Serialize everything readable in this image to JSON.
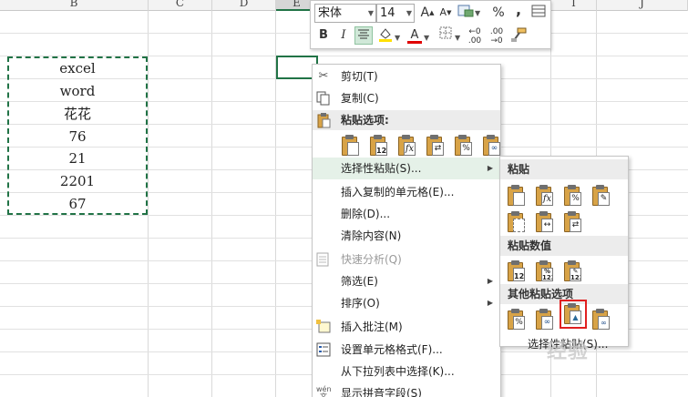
{
  "columns": [
    {
      "label": "B",
      "active": false
    },
    {
      "label": "C",
      "active": false
    },
    {
      "label": "D",
      "active": false
    },
    {
      "label": "E",
      "active": true
    },
    {
      "label": "I",
      "active": false
    },
    {
      "label": "J",
      "active": false
    }
  ],
  "cells": [
    "excel",
    "word",
    "花花",
    "76",
    "21",
    "2201",
    "67"
  ],
  "mini_toolbar": {
    "font_name": "宋体",
    "font_size": "14",
    "grow_font": "A",
    "shrink_font": "A",
    "percent": "%",
    "comma": ",",
    "bold": "B",
    "italic": "I",
    "font_color_letter": "A",
    "increase_decimal": ".00",
    "decrease_decimal": ".00",
    "accent_color": "#217346",
    "font_color": "#e00000",
    "fill_color": "#ffe000"
  },
  "context_menu": {
    "cut": "剪切(T)",
    "copy": "复制(C)",
    "paste_options_header": "粘贴选项:",
    "paste_special": "选择性粘贴(S)...",
    "insert_copied_cells": "插入复制的单元格(E)...",
    "delete": "删除(D)...",
    "clear_contents": "清除内容(N)",
    "quick_analysis": "快速分析(Q)",
    "filter": "筛选(E)",
    "sort": "排序(O)",
    "insert_comment": "插入批注(M)",
    "format_cells": "设置单元格格式(F)...",
    "pick_from_list": "从下拉列表中选择(K)...",
    "show_phonetic": "显示拼音字段(S)",
    "phonetic_icon_text": "wén"
  },
  "submenu": {
    "paste_header": "粘贴",
    "paste_values_header": "粘贴数值",
    "other_paste_header": "其他粘贴选项",
    "footer": "选择性粘贴(S)..."
  },
  "watermark": "经验"
}
